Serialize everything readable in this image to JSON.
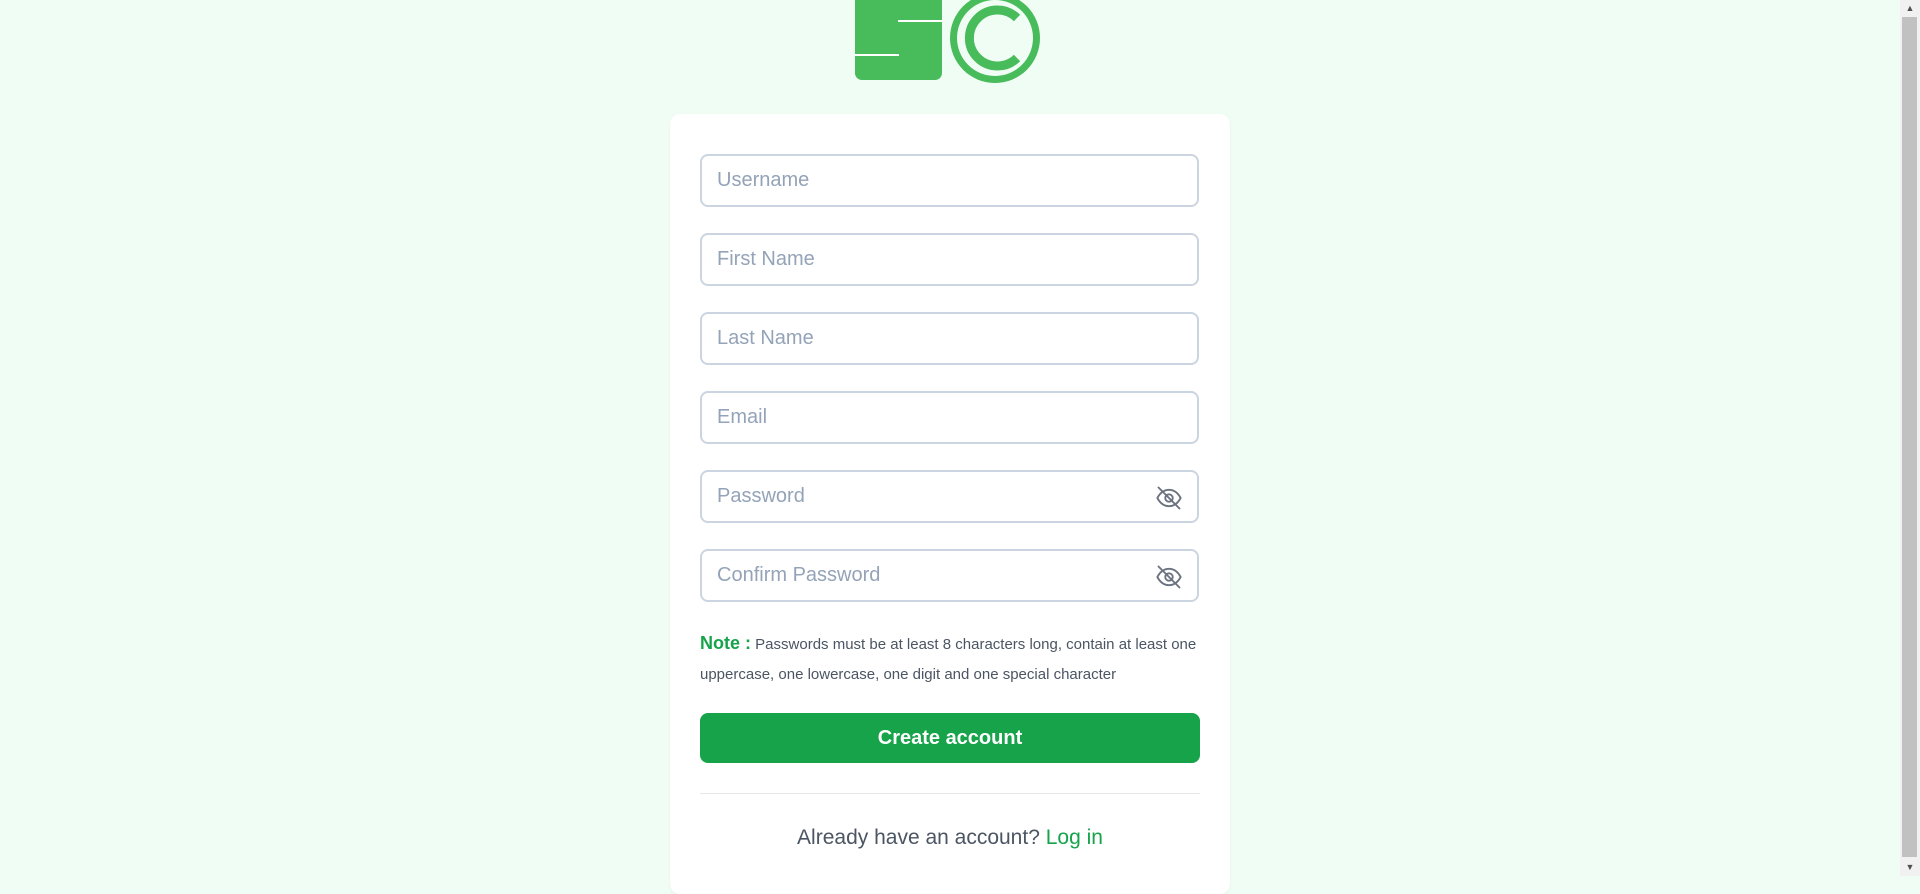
{
  "form": {
    "username_placeholder": "Username",
    "first_name_placeholder": "First Name",
    "last_name_placeholder": "Last Name",
    "email_placeholder": "Email",
    "password_placeholder": "Password",
    "confirm_password_placeholder": "Confirm Password"
  },
  "note": {
    "label": "Note :",
    "text": "Passwords must be at least 8 characters long, contain at least one uppercase, one lowercase, one digit and one special character"
  },
  "create_button_label": "Create account",
  "login_prompt": {
    "text": "Already have an account?",
    "link": "Log in"
  },
  "colors": {
    "accent": "#16a34a",
    "logo": "#48bb5a",
    "background": "#f0fdf4",
    "input_border": "#cbd5e1"
  },
  "icons": {
    "password_toggle": "eye-off-icon",
    "confirm_password_toggle": "eye-off-icon"
  }
}
